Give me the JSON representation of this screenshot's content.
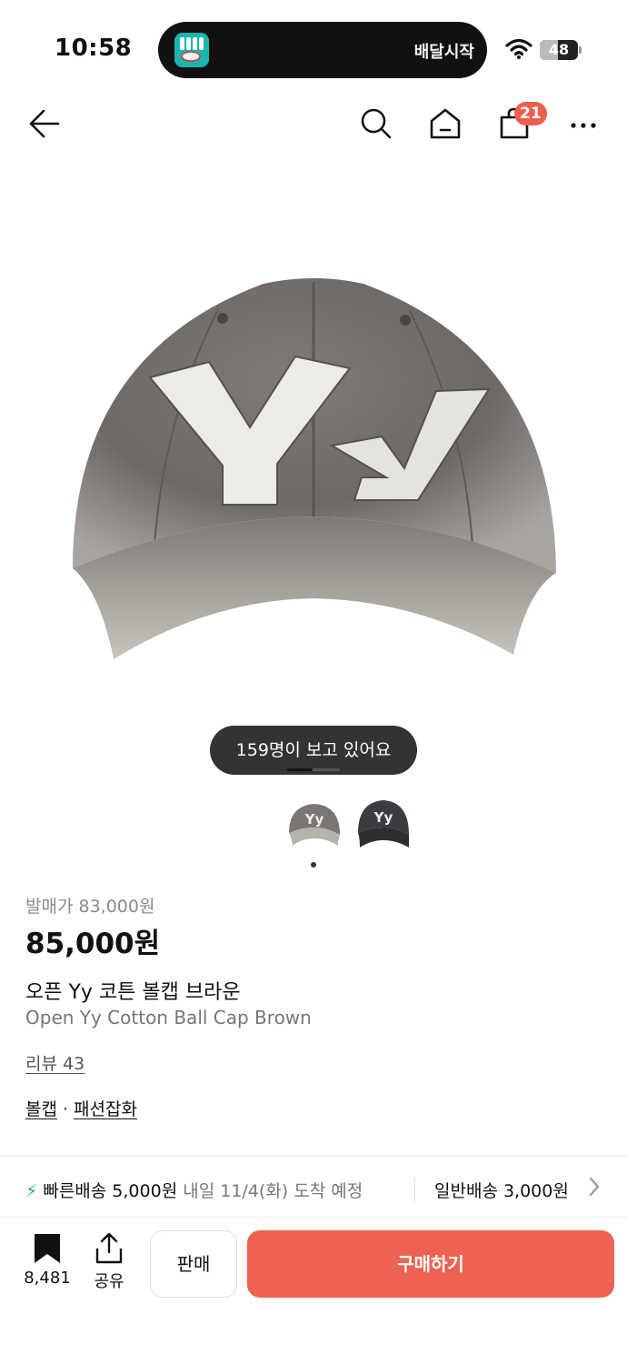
{
  "status_bar": {
    "time": "10:58",
    "activity_text": "배달시작",
    "battery_level": "48",
    "battery_percent": 48
  },
  "nav": {
    "cart_badge": "21",
    "icons": [
      "back-arrow-icon",
      "search-icon",
      "home-icon",
      "shopping-bag-icon",
      "more-icon"
    ]
  },
  "product": {
    "viewers_text": "159명이 보고 있어요",
    "release_price": "발매가 83,000원",
    "price": "85,000원",
    "title_ko": "오픈 Yy 코튼 볼캡 브라운",
    "title_en": "Open Yy Cotton Ball Cap Brown",
    "review_link": "리뷰 43",
    "category": {
      "primary": "볼캡",
      "separator": "·",
      "secondary": "패션잡화"
    },
    "image_logo_text": "Yy"
  },
  "shipping": {
    "fast_label": "빠른배송 5,000원",
    "fast_eta": "내일 11/4(화) 도착 예정",
    "normal_label": "일반배송 3,000원"
  },
  "bottom_bar": {
    "bookmark_count": "8,481",
    "share_label": "공유",
    "sell_label": "판매",
    "buy_label": "구매하기"
  },
  "colors": {
    "accent": "#ef6253",
    "badge": "#ef5e4e",
    "fast_bolt": "#1fbf5f"
  }
}
